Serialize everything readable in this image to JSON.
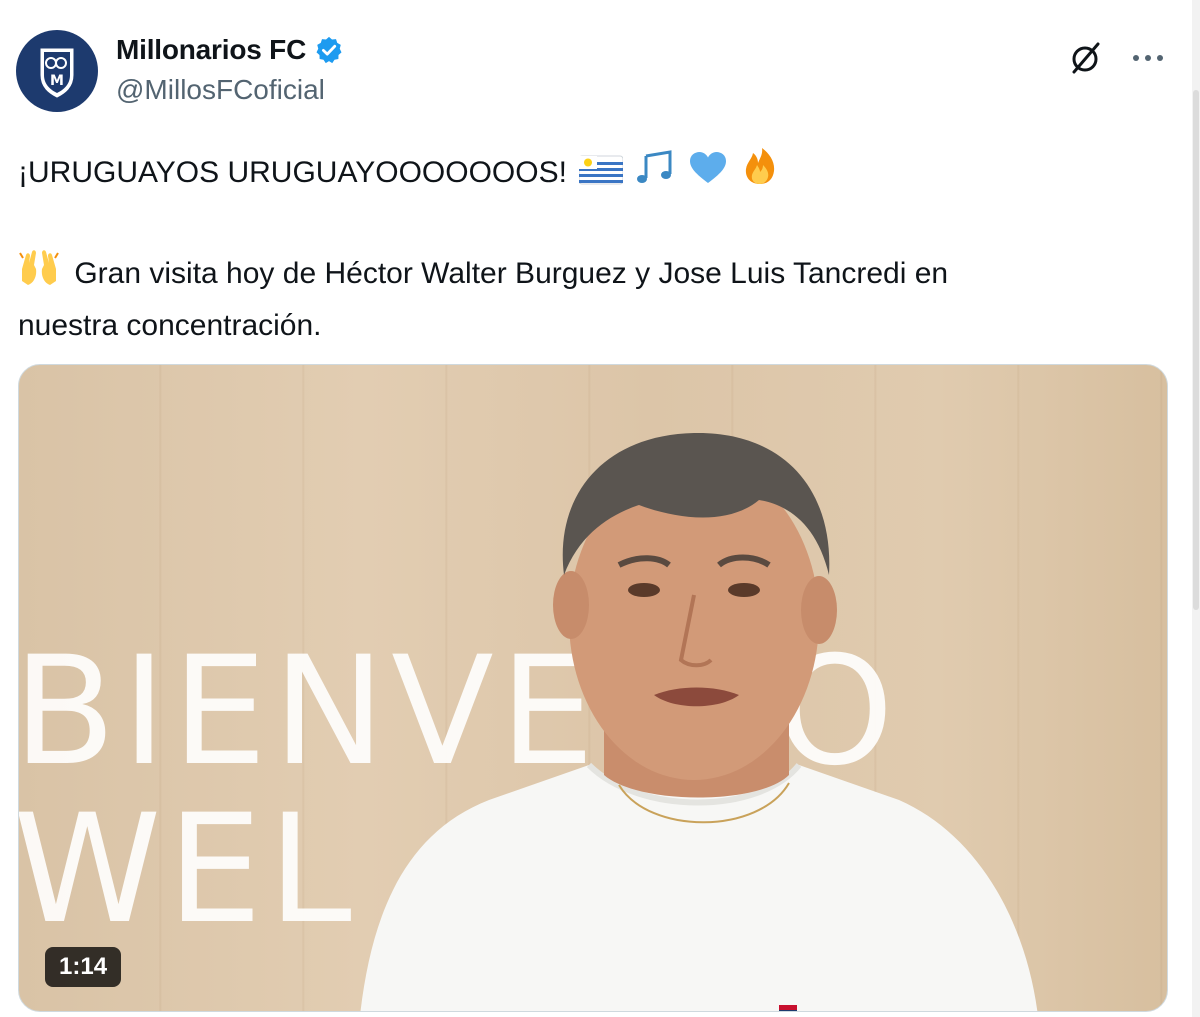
{
  "author": {
    "display_name": "Millonarios FC",
    "handle": "@MillosFCoficial",
    "verified": true,
    "avatar_icon": "millonarios-crest-icon",
    "avatar_color": "#1d3a6e"
  },
  "actions": {
    "grok_icon": "grok-icon",
    "more_icon": "more-options-icon"
  },
  "tweet": {
    "line1": "¡URUGUAYOS URUGUAYOOOOOOOS!",
    "line1_emojis": [
      "uruguay-flag-emoji",
      "music-notes-emoji",
      "blue-heart-emoji",
      "fire-emoji"
    ],
    "line2_emoji": "raising-hands-emoji",
    "line2": "Gran visita hoy de Héctor Walter Burguez y Jose Luis Tancredi en",
    "line3": "nuestra concentración."
  },
  "media": {
    "wall_text_line1": "BIENVE  DO",
    "wall_text_line2": "WEL",
    "duration": "1:14"
  },
  "colors": {
    "verified_blue": "#1d9bf0",
    "text_primary": "#0f1419",
    "text_secondary": "#536471"
  }
}
